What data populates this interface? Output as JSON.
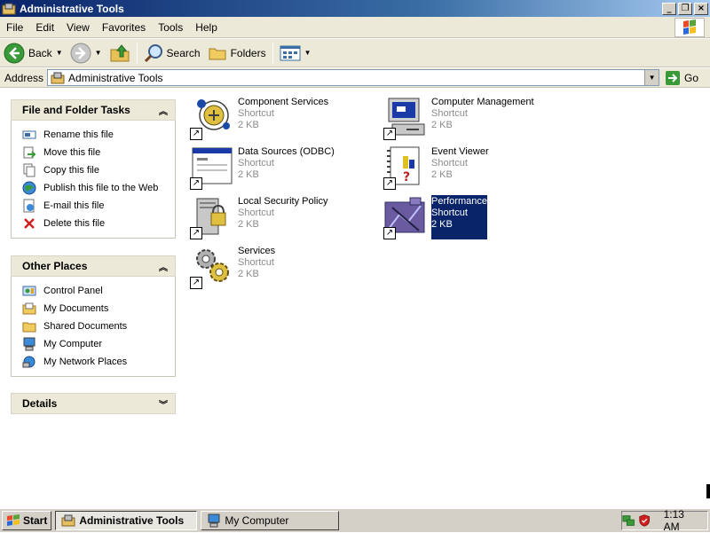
{
  "window": {
    "title": "Administrative Tools"
  },
  "menubar": {
    "items": [
      "File",
      "Edit",
      "View",
      "Favorites",
      "Tools",
      "Help"
    ]
  },
  "toolbar": {
    "back_label": "Back",
    "search_label": "Search",
    "folders_label": "Folders"
  },
  "address": {
    "label": "Address",
    "value": "Administrative Tools",
    "go_label": "Go"
  },
  "tasks_panel": {
    "title": "File and Folder Tasks",
    "items": [
      "Rename this file",
      "Move this file",
      "Copy this file",
      "Publish this file to the Web",
      "E-mail this file",
      "Delete this file"
    ]
  },
  "places_panel": {
    "title": "Other Places",
    "items": [
      "Control Panel",
      "My Documents",
      "Shared Documents",
      "My Computer",
      "My Network Places"
    ]
  },
  "details_panel": {
    "title": "Details"
  },
  "files": [
    {
      "name": "Component Services",
      "type": "Shortcut",
      "size": "2 KB"
    },
    {
      "name": "Computer Management",
      "type": "Shortcut",
      "size": "2 KB"
    },
    {
      "name": "Data Sources (ODBC)",
      "type": "Shortcut",
      "size": "2 KB"
    },
    {
      "name": "Event Viewer",
      "type": "Shortcut",
      "size": "2 KB"
    },
    {
      "name": "Local Security Policy",
      "type": "Shortcut",
      "size": "2 KB"
    },
    {
      "name": "Performance",
      "type": "Shortcut",
      "size": "2 KB",
      "selected": true
    },
    {
      "name": "Services",
      "type": "Shortcut",
      "size": "2 KB"
    }
  ],
  "taskbar": {
    "start_label": "Start",
    "buttons": [
      {
        "label": "Administrative Tools",
        "active": true
      },
      {
        "label": "My Computer",
        "active": false
      }
    ],
    "clock": "1:13 AM"
  },
  "colors": {
    "selection": "#0a246a",
    "titlebar": "#0a246a",
    "panel_header": "#ece9d8"
  }
}
